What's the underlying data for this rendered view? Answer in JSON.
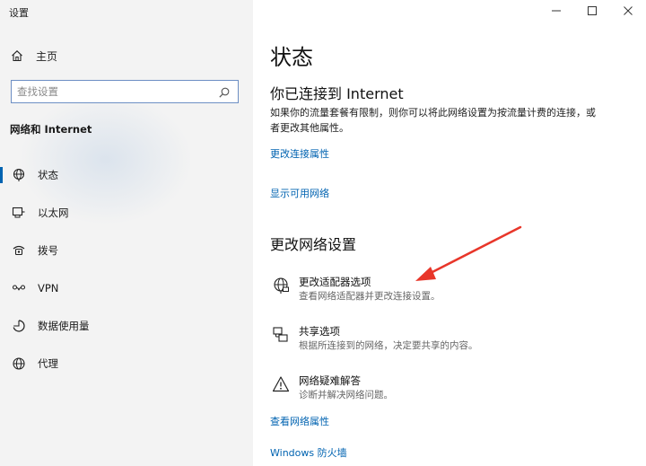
{
  "window": {
    "title": "设置",
    "controls": [
      "minimize-icon",
      "maximize-icon",
      "close-icon"
    ]
  },
  "sidebar": {
    "home_label": "主页",
    "search_placeholder": "查找设置",
    "section_title": "网络和 Internet",
    "items": [
      {
        "label": "状态",
        "icon": "globe-status-icon",
        "active": true
      },
      {
        "label": "以太网",
        "icon": "ethernet-icon",
        "active": false
      },
      {
        "label": "拨号",
        "icon": "dialup-icon",
        "active": false
      },
      {
        "label": "VPN",
        "icon": "vpn-icon",
        "active": false
      },
      {
        "label": "数据使用量",
        "icon": "data-usage-icon",
        "active": false
      },
      {
        "label": "代理",
        "icon": "globe-proxy-icon",
        "active": false
      }
    ]
  },
  "main": {
    "title": "状态",
    "connection": {
      "heading": "你已连接到 Internet",
      "description": "如果你的流量套餐有限制，则你可以将此网络设置为按流量计费的连接，或者更改其他属性。"
    },
    "links": {
      "change_connection_properties": "更改连接属性",
      "show_available_networks": "显示可用网络",
      "view_network_properties": "查看网络属性",
      "windows_firewall": "Windows 防火墙"
    },
    "change_section": {
      "heading": "更改网络设置",
      "options": [
        {
          "title": "更改适配器选项",
          "desc": "查看网络适配器并更改连接设置。",
          "icon": "adapter-icon"
        },
        {
          "title": "共享选项",
          "desc": "根据所连接到的网络，决定要共享的内容。",
          "icon": "sharing-icon"
        },
        {
          "title": "网络疑难解答",
          "desc": "诊断并解决网络问题。",
          "icon": "warning-icon"
        }
      ]
    }
  },
  "colors": {
    "accent": "#0063b1",
    "sidebar_bg": "#f3f3f3",
    "annotation_arrow": "#e8362a"
  }
}
